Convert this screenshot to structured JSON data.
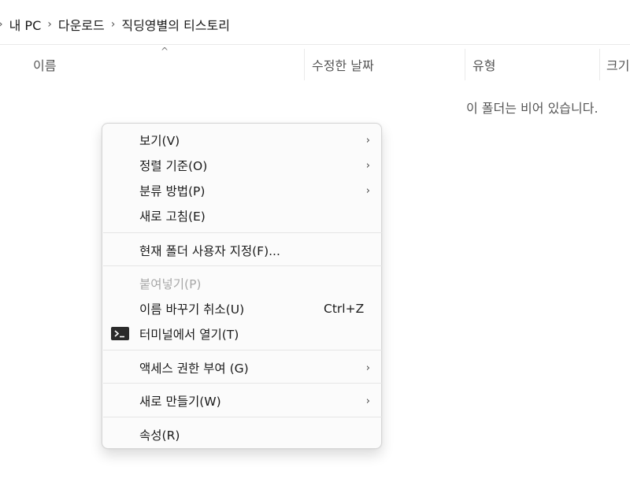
{
  "breadcrumb": {
    "items": [
      "내 PC",
      "다운로드",
      "직딩영별의 티스토리"
    ]
  },
  "columns": {
    "name": "이름",
    "date": "수정한 날짜",
    "type": "유형",
    "size": "크기"
  },
  "empty_message": "이 폴더는 비어 있습니다.",
  "context_menu": {
    "items": [
      {
        "label": "보기(V)",
        "submenu": true
      },
      {
        "label": "정렬 기준(O)",
        "submenu": true
      },
      {
        "label": "분류 방법(P)",
        "submenu": true
      },
      {
        "label": "새로 고침(E)",
        "submenu": false
      },
      {
        "label": "현재 폴더 사용자 지정(F)...",
        "submenu": false
      },
      {
        "label": "붙여넣기(P)",
        "submenu": false,
        "disabled": true
      },
      {
        "label": "이름 바꾸기 취소(U)",
        "submenu": false,
        "shortcut": "Ctrl+Z"
      },
      {
        "label": "터미널에서 열기(T)",
        "submenu": false,
        "icon": "terminal-icon"
      },
      {
        "label": "액세스 권한 부여 (G)",
        "submenu": true
      },
      {
        "label": "새로 만들기(W)",
        "submenu": true
      },
      {
        "label": "속성(R)",
        "submenu": false
      }
    ]
  },
  "glyphs": {
    "chevron": "›",
    "sort_caret": "^"
  }
}
